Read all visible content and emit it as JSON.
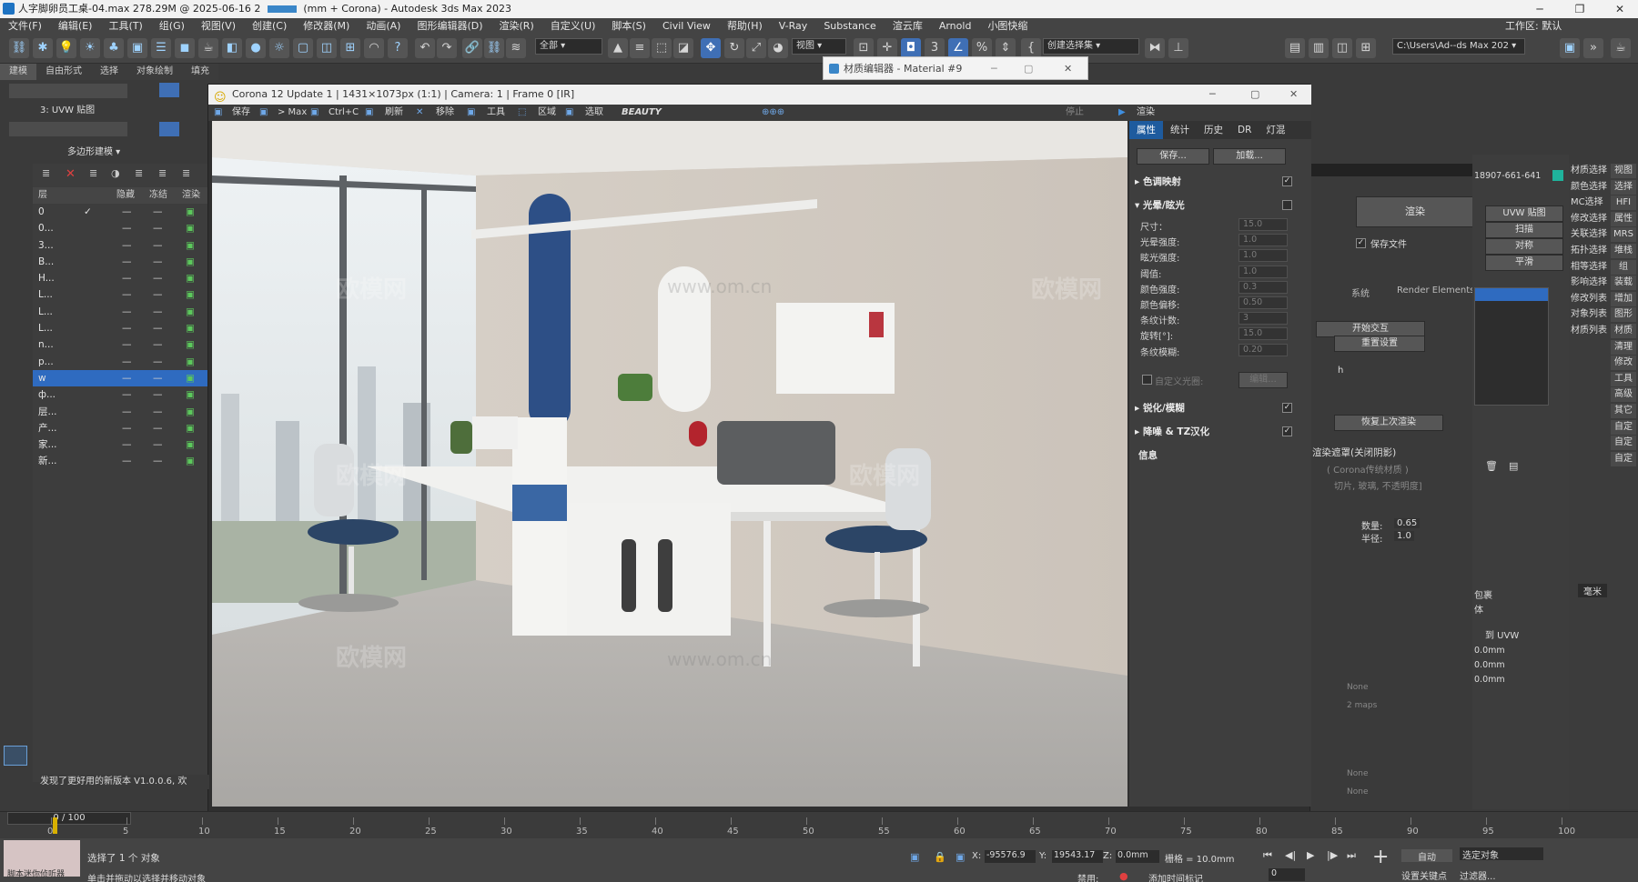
{
  "app": {
    "window_title": "人字脚卵员工桌-04.max  278.29M @ 2025-06-16 2",
    "window_title_tail": "(mm + Corona) - Autodesk 3ds Max 2023",
    "workspace_label": "工作区: 默认"
  },
  "menu": [
    "文件(F)",
    "编辑(E)",
    "工具(T)",
    "组(G)",
    "视图(V)",
    "创建(C)",
    "修改器(M)",
    "动画(A)",
    "图形编辑器(D)",
    "渲染(R)",
    "自定义(U)",
    "脚本(S)",
    "Civil View",
    "帮助(H)",
    "V-Ray",
    "Substance",
    "渲云库",
    "Arnold",
    "小图快缩"
  ],
  "toolbar": {
    "selection_filter": "全部",
    "view_combo": "视图",
    "named_selection": "创建选择集",
    "path_combo": "C:\\Users\\Ad--ds Max 202"
  },
  "ribbon": {
    "tabs": [
      "建模",
      "自由形式",
      "选择",
      "对象绘制",
      "填充"
    ],
    "uvw_label": "3: UVW 贴图",
    "poly_modeling": "多边形建模"
  },
  "layers": {
    "headers": {
      "name": "层",
      "hide": "隐藏",
      "freeze": "冻结",
      "render": "渲染"
    },
    "rows": [
      {
        "name": "0",
        "check": "✓"
      },
      {
        "name": "0...",
        "check": ""
      },
      {
        "name": "3...",
        "check": ""
      },
      {
        "name": "B...",
        "check": ""
      },
      {
        "name": "H...",
        "check": ""
      },
      {
        "name": "L...",
        "check": ""
      },
      {
        "name": "L...",
        "check": ""
      },
      {
        "name": "L...",
        "check": ""
      },
      {
        "name": "n...",
        "check": ""
      },
      {
        "name": "p...",
        "check": ""
      },
      {
        "name": "w",
        "check": ""
      },
      {
        "name": "ф...",
        "check": ""
      },
      {
        "name": "层...",
        "check": ""
      },
      {
        "name": "产...",
        "check": ""
      },
      {
        "name": "家...",
        "check": ""
      },
      {
        "name": "新...",
        "check": ""
      }
    ],
    "dash": "—"
  },
  "material_editor": {
    "title": "材质编辑器 - Material #9"
  },
  "render_window": {
    "title": "Corona 12 Update 1 | 1431×1073px (1:1) | Camera: 1 | Frame 0 [IR]",
    "toolbar": [
      "保存",
      "> Max",
      "Ctrl+C",
      "刷新",
      "移除",
      "工具",
      "区域",
      "选取"
    ],
    "channel": "BEAUTY",
    "stop": "停止",
    "render": "渲染",
    "tabs": [
      "属性",
      "统计",
      "历史",
      "DR",
      "灯混"
    ],
    "save_btn": "保存...",
    "load_btn": "加载...",
    "sections": {
      "tone": "色调映射",
      "bloom": "光晕/眩光",
      "sharpen": "锐化/模糊",
      "denoise": "降噪 & TZ汉化",
      "info": "信息"
    },
    "bloom_params": [
      {
        "label": "尺寸：",
        "value": "15.0"
      },
      {
        "label": "光晕强度:",
        "value": "1.0"
      },
      {
        "label": "眩光强度:",
        "value": "1.0"
      },
      {
        "label": "阈值:",
        "value": "1.0"
      },
      {
        "label": "颜色强度:",
        "value": "0.3"
      },
      {
        "label": "颜色偏移:",
        "value": "0.50"
      },
      {
        "label": "条纹计数:",
        "value": "3"
      },
      {
        "label": "旋转[°]:",
        "value": "15.0"
      },
      {
        "label": "条纹模糊:",
        "value": "0.20"
      }
    ],
    "custom_aperture": "自定义光圈:",
    "edit": "编辑..."
  },
  "render_setup": {
    "render_btn": "渲染",
    "save_file": "保存文件",
    "system": "系统",
    "render_elements": "Render Elements",
    "start_interactive": "开始交互",
    "reset_settings": "重置设置",
    "restore_last": "恢复上次渲染",
    "shadow_mask": "渲染遮罩(关闭阴影)",
    "corona_material": "( Corona传统材质 )",
    "cut_glass": "切片, 玻璃, 不透明度]",
    "amount_label": "数量:",
    "amount": "0.65",
    "radius_label": "半径:",
    "radius": "1.0",
    "none1": "None",
    "maps": "2 maps",
    "none2": "None",
    "none3": "None",
    "h_label": "h",
    "phone": "18907-661-641"
  },
  "right_panel": {
    "uvw": "UVW 贴图",
    "scan": "扫描",
    "symmetry": "对称",
    "smooth": "平滑",
    "package": "包裹",
    "body": "体",
    "to_uvw": "到 UVW",
    "unit": "毫米",
    "value_rows": [
      "0.0mm",
      "0.0mm",
      "0.0mm"
    ]
  },
  "command_col": [
    {
      "a": "材质选择",
      "b": "视图"
    },
    {
      "a": "颜色选择",
      "b": "选择"
    },
    {
      "a": "MC选择",
      "b": "HFI"
    },
    {
      "a": "修改选择",
      "b": "属性"
    },
    {
      "a": "关联选择",
      "b": "MRS"
    },
    {
      "a": "拓扑选择",
      "b": "堆栈"
    },
    {
      "a": "相等选择",
      "b": "组"
    },
    {
      "a": "影响选择",
      "b": "装载"
    },
    {
      "a": "修改列表",
      "b": "增加"
    },
    {
      "a": "对象列表",
      "b": "图形"
    },
    {
      "a": "材质列表",
      "b": "材质"
    },
    {
      "a": "",
      "b": "清理"
    },
    {
      "a": "",
      "b": "修改"
    },
    {
      "a": "",
      "b": "工具"
    },
    {
      "a": "",
      "b": "高级"
    },
    {
      "a": "",
      "b": "其它"
    },
    {
      "a": "",
      "b": "自定"
    },
    {
      "a": "",
      "b": "自定"
    },
    {
      "a": "",
      "b": "自定"
    }
  ],
  "timeline": {
    "frame": "0 / 100",
    "ticks": [
      "0",
      "5",
      "10",
      "15",
      "20",
      "25",
      "30",
      "35",
      "40",
      "45",
      "50",
      "55",
      "60",
      "65",
      "70",
      "75",
      "80",
      "85",
      "90",
      "95",
      "100"
    ]
  },
  "status": {
    "update_notice": "发现了更好用的新版本 V1.0.0.6, 欢",
    "selected": "选择了 1 个 对象",
    "hint": "单击并拖动以选择并移动对象",
    "script_listener": "脚本迷你侦听器",
    "x": "-95576.9",
    "y": "19543.17",
    "z": "0.0mm",
    "grid": "栅格 = 10.0mm",
    "auto": "自动",
    "set_key": "设置关键点",
    "selected_obj": "选定对象",
    "filter": "过滤器...",
    "add_time_tag": "添加时间标记",
    "disabled": "禁用:",
    "frame_field": "0"
  },
  "watermarks": {
    "brand": "欧模网",
    "url": "www.om.cn"
  }
}
